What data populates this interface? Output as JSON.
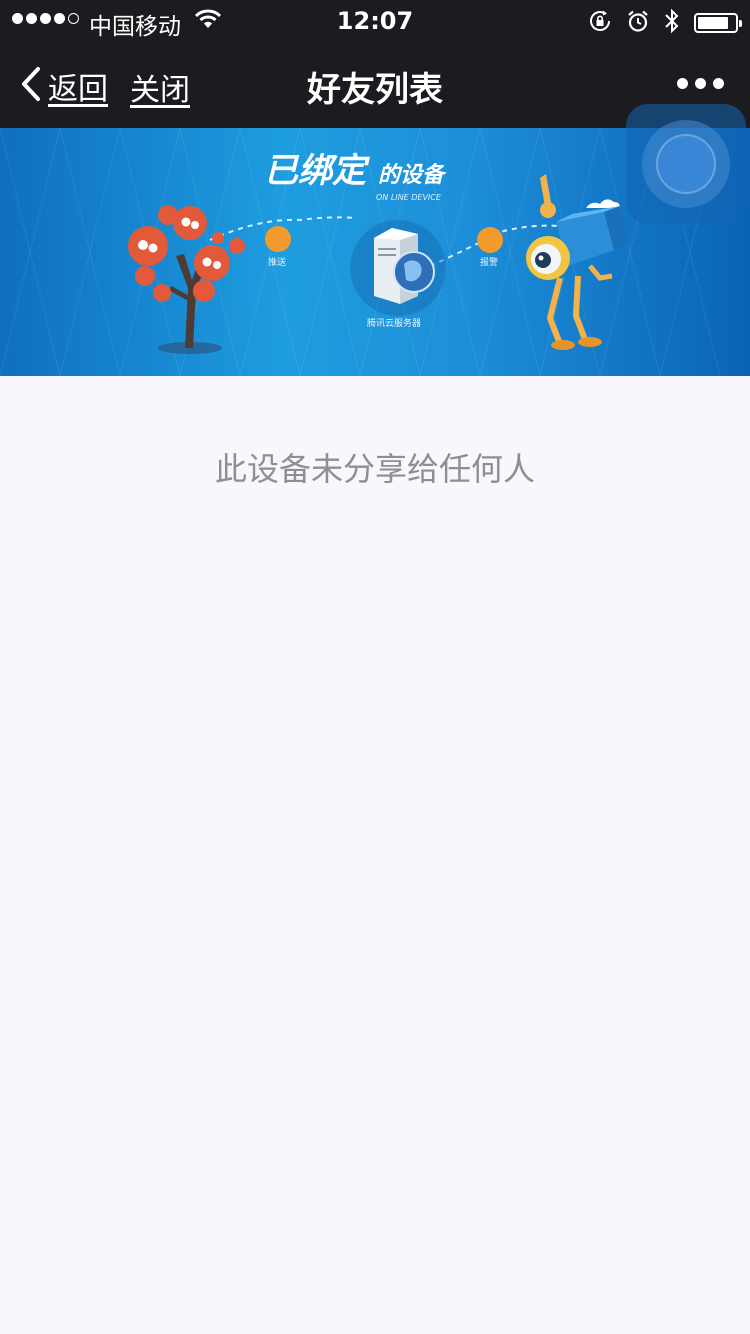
{
  "status_bar": {
    "carrier": "中国移动",
    "time": "12:07",
    "signal_bars": 4,
    "signal_max": 5,
    "battery_level": 0.85
  },
  "nav": {
    "back_label": "返回",
    "close_label": "关闭",
    "title": "好友列表",
    "more_icon": "more-icon"
  },
  "banner": {
    "title_main": "已绑定",
    "title_sub": "的设备",
    "subtitle_en": "ON LINE DEVICE",
    "label_push": "推送",
    "label_server": "腾讯云服务器",
    "label_alarm": "报警"
  },
  "content": {
    "empty_message": "此设备未分享给任何人"
  },
  "colors": {
    "bar_bg": "#1c1c20",
    "page_bg": "#f9f7fc",
    "message": "#8e8e93",
    "banner_blue": "#1d8fd8",
    "accent_orange": "#f39a2c"
  }
}
